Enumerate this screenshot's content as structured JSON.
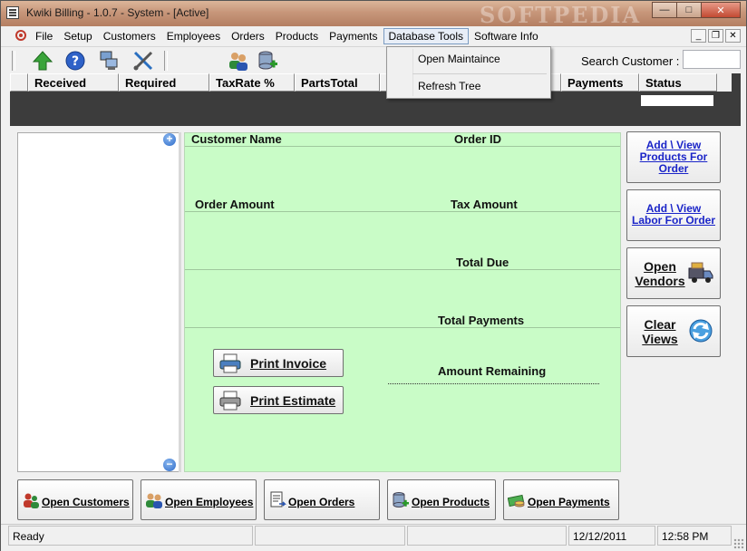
{
  "window": {
    "title": "Kwiki Billing - 1.0.7 - System - [Active]",
    "watermark": "SOFTPEDIA",
    "buttons": {
      "minimize": "—",
      "maximize": "□",
      "close": "✕"
    }
  },
  "menubar": {
    "items": [
      "File",
      "Setup",
      "Customers",
      "Employees",
      "Orders",
      "Products",
      "Payments",
      "Database Tools",
      "Software Info"
    ],
    "active_index": 7,
    "mdi": {
      "minimize": "_",
      "restore": "❐",
      "close": "✕"
    }
  },
  "dropdown": {
    "items": [
      "Open Maintaince",
      "Refresh Tree"
    ]
  },
  "toolbar": {
    "search_label": "Search Customer :",
    "search_value": ""
  },
  "grid": {
    "columns": [
      "Received",
      "Required",
      "TaxRate %",
      "PartsTotal",
      "",
      "",
      "Payments",
      "Status"
    ]
  },
  "info_panel": {
    "customer_name": "Customer Name",
    "order_id": "Order ID",
    "order_amount": "Order Amount",
    "tax_amount": "Tax Amount",
    "total_due": "Total Due",
    "total_payments": "Total Payments",
    "amount_remaining": "Amount Remaining",
    "print_invoice": "Print Invoice",
    "print_estimate": "Print Estimate"
  },
  "side_buttons": {
    "products_line1": "Add \\ View",
    "products_line2": "Products For",
    "products_line3": "Order",
    "labor_line1": "Add \\ View",
    "labor_line2": "Labor For Order",
    "vendors_line1": "Open",
    "vendors_line2": "Vendors",
    "clear_line1": "Clear",
    "clear_line2": "Views"
  },
  "bottom_buttons": [
    "Open Customers",
    "Open Employees",
    "Open Orders",
    "Open Products",
    "Open Payments"
  ],
  "statusbar": {
    "status": "Ready",
    "date": "12/12/2011",
    "time": "12:58 PM"
  },
  "icons": {
    "tree_expand": "+",
    "tree_collapse": "−"
  },
  "colors": {
    "panel_green": "#c9fcc7",
    "link_blue": "#1a24c8",
    "grid_dark": "#3c3c3c"
  }
}
